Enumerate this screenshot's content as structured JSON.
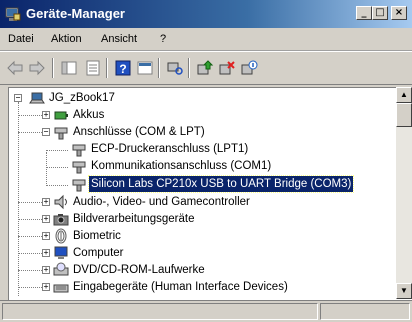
{
  "window": {
    "title": "Geräte-Manager",
    "minimize": "_",
    "maximize": "□",
    "close": "×"
  },
  "menu": {
    "items": [
      "Datei",
      "Aktion",
      "Ansicht",
      "?"
    ]
  },
  "toolbar": {
    "icons": [
      "back-arrow-icon",
      "forward-arrow-icon",
      "console-tree-icon",
      "properties-icon",
      "help-icon",
      "view-icon",
      "scan-hardware-icon",
      "update-driver-icon",
      "uninstall-icon",
      "disable-icon"
    ]
  },
  "tree": {
    "root": "JG_zBook17",
    "nodes": [
      {
        "label": "Akkus",
        "expander": "+"
      },
      {
        "label": "Anschlüsse (COM & LPT)",
        "expander": "−"
      },
      {
        "label": "ECP-Druckeranschluss (LPT1)"
      },
      {
        "label": "Kommunikationsanschluss (COM1)"
      },
      {
        "label": "Silicon Labs CP210x USB to UART Bridge (COM3)",
        "selected": true
      },
      {
        "label": "Audio-, Video- und Gamecontroller",
        "expander": "+"
      },
      {
        "label": "Bildverarbeitungsgeräte",
        "expander": "+"
      },
      {
        "label": "Biometric",
        "expander": "+"
      },
      {
        "label": "Computer",
        "expander": "+"
      },
      {
        "label": "DVD/CD-ROM-Laufwerke",
        "expander": "+"
      },
      {
        "label": "Eingabegeräte (Human Interface Devices)",
        "expander": "+"
      }
    ]
  },
  "colors": {
    "title_start": "#0a246a",
    "title_end": "#a6caf0",
    "selection": "#0a246a",
    "face": "#d4d0c8"
  }
}
